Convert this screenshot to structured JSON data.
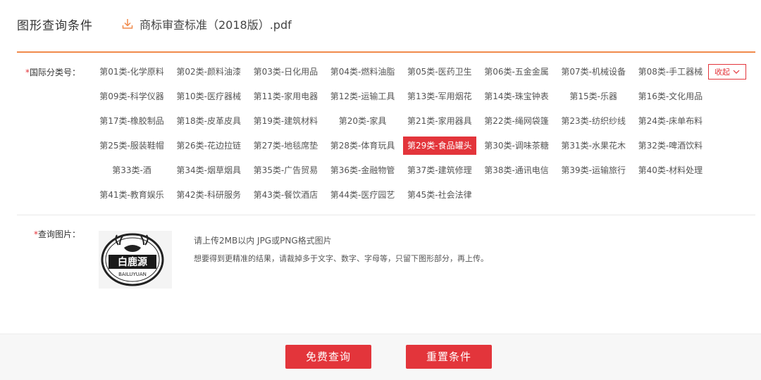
{
  "header": {
    "title": "图形查询条件",
    "pdf_link": "商标审查标准（2018版）.pdf"
  },
  "classification": {
    "label": "国际分类号：",
    "required_mark": "*",
    "collapse_label": "收起",
    "selected": "第29类-食品罐头",
    "items": [
      "第01类-化学原料",
      "第02类-颜料油漆",
      "第03类-日化用品",
      "第04类-燃料油脂",
      "第05类-医药卫生",
      "第06类-五金金属",
      "第07类-机械设备",
      "第08类-手工器械",
      "第09类-科学仪器",
      "第10类-医疗器械",
      "第11类-家用电器",
      "第12类-运输工具",
      "第13类-军用烟花",
      "第14类-珠宝钟表",
      "第15类-乐器",
      "第16类-文化用品",
      "第17类-橡胶制品",
      "第18类-皮革皮具",
      "第19类-建筑材料",
      "第20类-家具",
      "第21类-家用器具",
      "第22类-绳网袋篷",
      "第23类-纺织纱线",
      "第24类-床单布料",
      "第25类-服装鞋帽",
      "第26类-花边拉链",
      "第27类-地毯席垫",
      "第28类-体育玩具",
      "第29类-食品罐头",
      "第30类-调味茶糖",
      "第31类-水果花木",
      "第32类-啤酒饮料",
      "第33类-酒",
      "第34类-烟草烟具",
      "第35类-广告贸易",
      "第36类-金融物管",
      "第37类-建筑修理",
      "第38类-通讯电信",
      "第39类-运输旅行",
      "第40类-材料处理",
      "第41类-教育娱乐",
      "第42类-科研服务",
      "第43类-餐饮酒店",
      "第44类-医疗园艺",
      "第45类-社会法律"
    ]
  },
  "image_query": {
    "label": "查询图片：",
    "required_mark": "*",
    "logo_text_cn": "白鹿源",
    "logo_text_en": "BAILUYUAN",
    "hint_primary": "请上传2MB以内 JPG或PNG格式图片",
    "hint_secondary": "想要得到更精准的结果，请裁掉多于文字、数字、字母等，只留下图形部分，再上传。"
  },
  "actions": {
    "search_label": "免费查询",
    "reset_label": "重置条件"
  },
  "colors": {
    "accent": "#e3353b",
    "header_line": "#f08a4b"
  }
}
